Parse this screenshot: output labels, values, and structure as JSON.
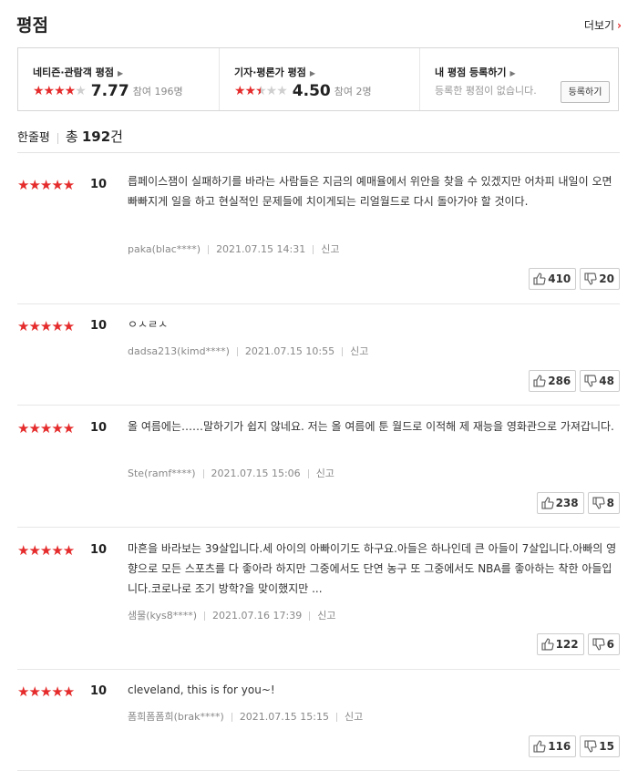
{
  "header": {
    "title": "평점",
    "more_label": "더보기"
  },
  "summary": {
    "audience": {
      "label": "네티즌·관람객 평점",
      "score": "7.77",
      "count": "참여 196명",
      "stars": 3.9
    },
    "critic": {
      "label": "기자·평론가 평점",
      "score": "4.50",
      "count": "참여 2명",
      "stars": 2.25
    },
    "mine": {
      "label": "내 평점 등록하기",
      "empty_text": "등록한 평점이 없습니다.",
      "button": "등록하기"
    }
  },
  "overview": {
    "label": "한줄평",
    "total_prefix": "총",
    "total_count": "192",
    "total_suffix": "건"
  },
  "report_label": "신고",
  "colors": {
    "accent": "#e52b2b",
    "star_off": "#cfcfcf"
  },
  "reviews": [
    {
      "stars": "★★★★★",
      "score": "10",
      "text": "릅페이스잼이 실패하기를 바라는 사람들은 지금의 예매율에서 위안을 찾을 수 있겠지만 어차피 내일이 오면 빠빠지게 일을 하고 현실적인 문제들에 치이게되는 리얼월드로 다시 돌아가야 할 것이다.",
      "user": "paka(blac****)",
      "date": "2021.07.15 14:31",
      "likes": "410",
      "dislikes": "20"
    },
    {
      "stars": "★★★★★",
      "score": "10",
      "text": "ㅇㅅㄹㅅ",
      "user": "dadsa213(kimd****)",
      "date": "2021.07.15 10:55",
      "likes": "286",
      "dislikes": "48"
    },
    {
      "stars": "★★★★★",
      "score": "10",
      "text": "올 여름에는……말하기가 쉽지 않네요. 저는 올 여름에 툰 월드로 이적해 제 재능을 영화관으로 가져갑니다.",
      "user": "Ste(ramf****)",
      "date": "2021.07.15 15:06",
      "likes": "238",
      "dislikes": "8"
    },
    {
      "stars": "★★★★★",
      "score": "10",
      "text": "마흔을 바라보는 39살입니다.세 아이의 아빠이기도 하구요.아들은 하나인데 큰 아들이 7살입니다.아빠의 영향으로 모든 스포츠를 다 좋아라 하지만 그중에서도 단연 농구 또 그중에서도 NBA를 좋아하는 착한 아들입니다.코로나로 조기 방학?을 맞이했지만 ...",
      "user": "샘물(kys8****)",
      "date": "2021.07.16 17:39",
      "likes": "122",
      "dislikes": "6"
    },
    {
      "stars": "★★★★★",
      "score": "10",
      "text": "cleveland, this is for you~!",
      "user": "폼희폼폼희(brak****)",
      "date": "2021.07.15 15:15",
      "likes": "116",
      "dislikes": "15"
    }
  ]
}
